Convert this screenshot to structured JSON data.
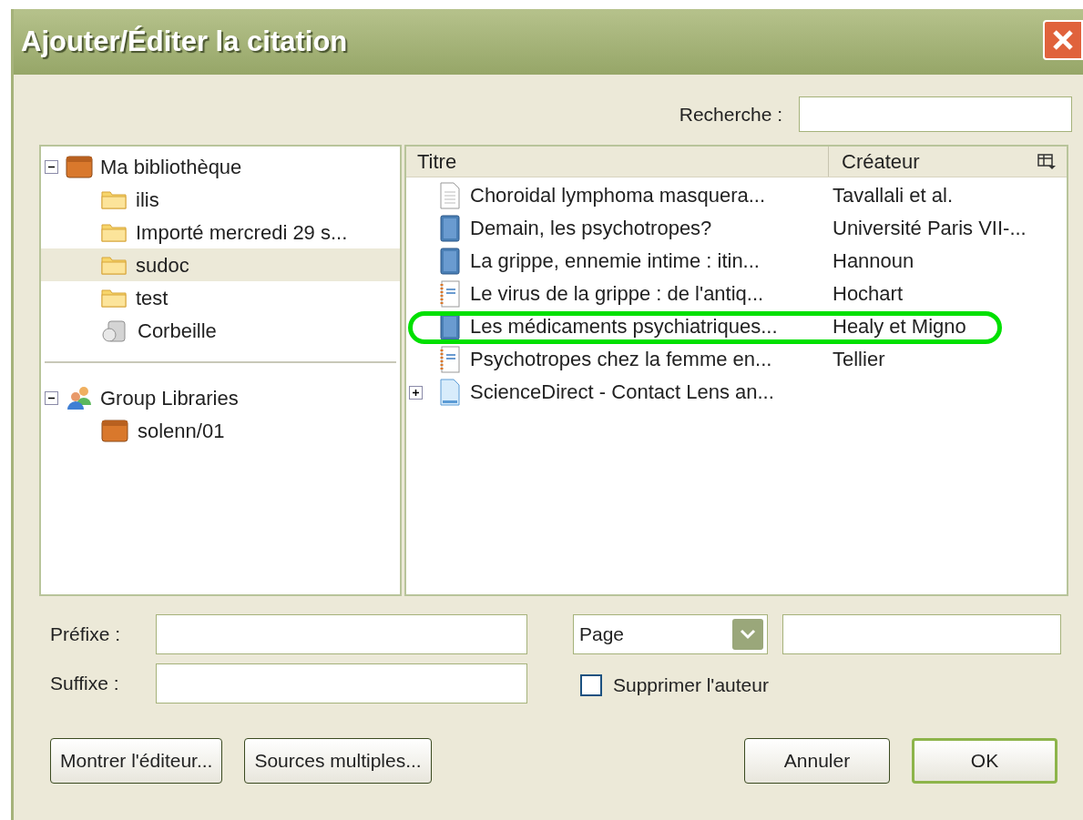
{
  "window": {
    "title": "Ajouter/Éditer la citation"
  },
  "search": {
    "label": "Recherche :"
  },
  "libraries": [
    {
      "label": "Ma bibliothèque",
      "kind": "library",
      "expanded": true,
      "selected": false,
      "children": [
        {
          "label": "ilis",
          "kind": "folder",
          "selected": false
        },
        {
          "label": "Importé mercredi 29 s...",
          "kind": "folder",
          "selected": false
        },
        {
          "label": "sudoc",
          "kind": "folder",
          "selected": true
        },
        {
          "label": "test",
          "kind": "folder",
          "selected": false
        },
        {
          "label": "Corbeille",
          "kind": "trash",
          "selected": false
        }
      ]
    },
    {
      "label": "Group Libraries",
      "kind": "group",
      "expanded": true,
      "selected": false,
      "children": [
        {
          "label": "solenn/01",
          "kind": "library",
          "selected": false
        }
      ]
    }
  ],
  "table": {
    "columns": [
      "Titre",
      "Créateur"
    ],
    "rows": [
      {
        "kind": "document",
        "title": "Choroidal lymphoma masquera...",
        "creator": "Tavallali et al."
      },
      {
        "kind": "book",
        "title": "Demain, les psychotropes?",
        "creator": "Université Paris VII-..."
      },
      {
        "kind": "book",
        "title": "La grippe, ennemie intime : itin...",
        "creator": "Hannoun"
      },
      {
        "kind": "notebook",
        "title": "Le virus de la grippe : de l'antiq...",
        "creator": "Hochart"
      },
      {
        "kind": "book",
        "title": "Les médicaments psychiatriques...",
        "creator": "Healy et Migno"
      },
      {
        "kind": "notebook",
        "title": "Psychotropes chez la femme en...",
        "creator": "Tellier"
      },
      {
        "kind": "webpage",
        "title": "ScienceDirect - Contact Lens an...",
        "creator": "",
        "expanded": false
      }
    ]
  },
  "prefix": {
    "label": "Préfixe :"
  },
  "suffix": {
    "label": "Suffixe :"
  },
  "locator": {
    "value": "Page"
  },
  "suppress_author": {
    "label": "Supprimer l'auteur",
    "checked": false
  },
  "buttons": [
    {
      "label": "Montrer l'éditeur...",
      "default": false
    },
    {
      "label": "Sources multiples...",
      "default": false
    },
    {
      "label": "Annuler",
      "default": false
    },
    {
      "label": "OK",
      "default": true
    }
  ]
}
